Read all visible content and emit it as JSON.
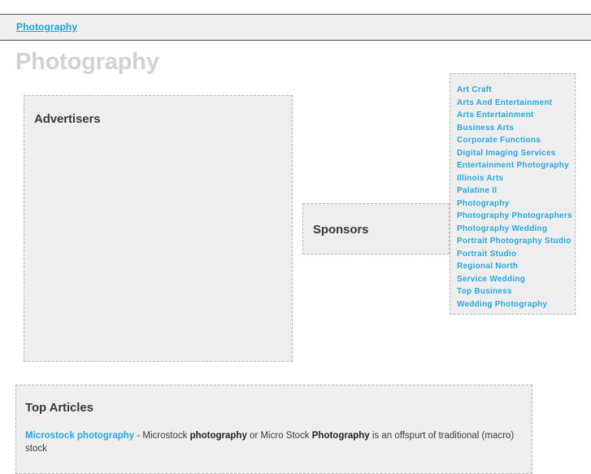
{
  "nav": {
    "items": [
      {
        "label": "Photography"
      }
    ]
  },
  "page": {
    "title": "Photography"
  },
  "panels": {
    "advertisers": {
      "heading": "Advertisers"
    },
    "sponsors": {
      "heading": "Sponsors"
    },
    "top_articles": {
      "heading": "Top Articles"
    }
  },
  "sidebar": {
    "links": [
      {
        "label": "Art Craft"
      },
      {
        "label": "Arts And Entertainment"
      },
      {
        "label": "Arts Entertainment"
      },
      {
        "label": "Business Arts"
      },
      {
        "label": "Corporate Functions"
      },
      {
        "label": "Digital Imaging Services"
      },
      {
        "label": "Entertainment Photography"
      },
      {
        "label": "Illinois Arts"
      },
      {
        "label": "Palatine Il"
      },
      {
        "label": "Photography"
      },
      {
        "label": "Photography Photographers"
      },
      {
        "label": "Photography Wedding"
      },
      {
        "label": "Portrait Photography Studio"
      },
      {
        "label": "Portrait Studio"
      },
      {
        "label": "Regional North"
      },
      {
        "label": "Service Wedding"
      },
      {
        "label": "Top Business"
      },
      {
        "label": "Wedding Photography"
      }
    ]
  },
  "articles": [
    {
      "link_text": "Microstock photography",
      "separator": " - ",
      "part1": "Microstock ",
      "bold1": "photography",
      "part2": " or Micro Stock ",
      "bold2": "Photography",
      "part3": " is an offspurt of traditional (macro) stock"
    }
  ],
  "colors": {
    "link_blue": "#27a9e0",
    "nav_blue": "#1fa0d8",
    "panel_bg": "#eeeeee",
    "panel_border": "#b6b6b6",
    "title_gray": "#d2d2d2"
  }
}
